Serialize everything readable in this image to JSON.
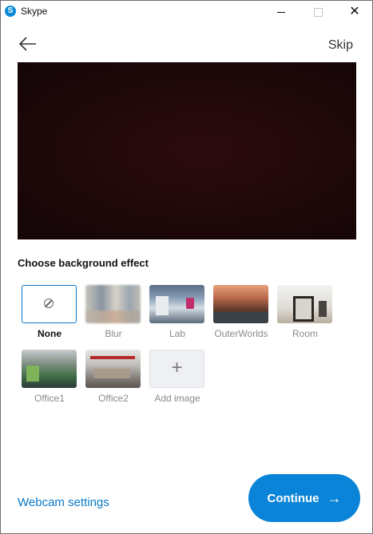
{
  "window": {
    "title": "Skype",
    "app_icon_letter": "S",
    "minimize_icon": "minimize-icon",
    "maximize_icon": "maximize-icon",
    "close_glyph": "✕"
  },
  "header": {
    "back_icon": "arrow-left-icon",
    "skip_label": "Skip"
  },
  "section_title": "Choose background effect",
  "effects": [
    {
      "label": "None",
      "selected": true,
      "icon": "ban-icon"
    },
    {
      "label": "Blur",
      "selected": false
    },
    {
      "label": "Lab",
      "selected": false
    },
    {
      "label": "OuterWorlds",
      "selected": false
    },
    {
      "label": "Room",
      "selected": false
    },
    {
      "label": "Office1",
      "selected": false
    },
    {
      "label": "Office2",
      "selected": false
    },
    {
      "label": "Add image",
      "selected": false,
      "icon": "plus-icon",
      "glyph": "+"
    }
  ],
  "footer": {
    "webcam_settings_label": "Webcam settings",
    "continue_label": "Continue",
    "continue_arrow": "→"
  },
  "colors": {
    "accent": "#0a84d8",
    "link": "#0a78c8",
    "preview_bg": "#1e0809"
  }
}
